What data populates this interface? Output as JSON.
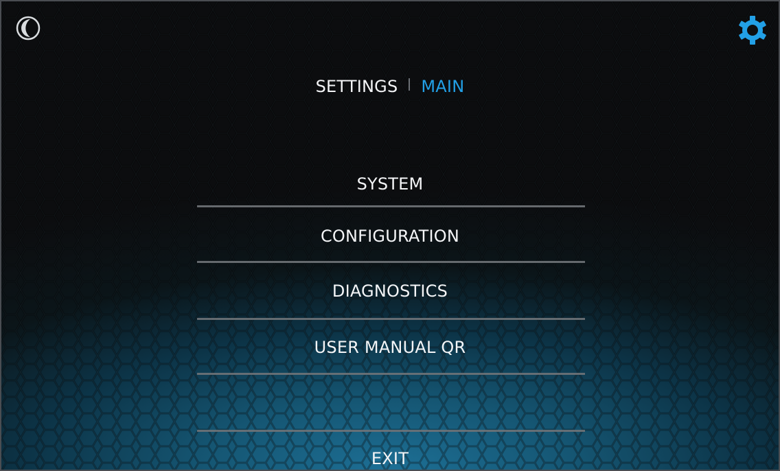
{
  "header": {
    "night_mode_icon": "moon-icon",
    "settings_icon": "gear-icon",
    "accent_color": "#22a0e6"
  },
  "breadcrumb": {
    "parent": "SETTINGS",
    "current": "MAIN"
  },
  "menu": {
    "items": [
      {
        "label": "SYSTEM"
      },
      {
        "label": "CONFIGURATION"
      },
      {
        "label": "DIAGNOSTICS"
      },
      {
        "label": "USER MANUAL QR"
      }
    ],
    "exit_label": "EXIT"
  }
}
